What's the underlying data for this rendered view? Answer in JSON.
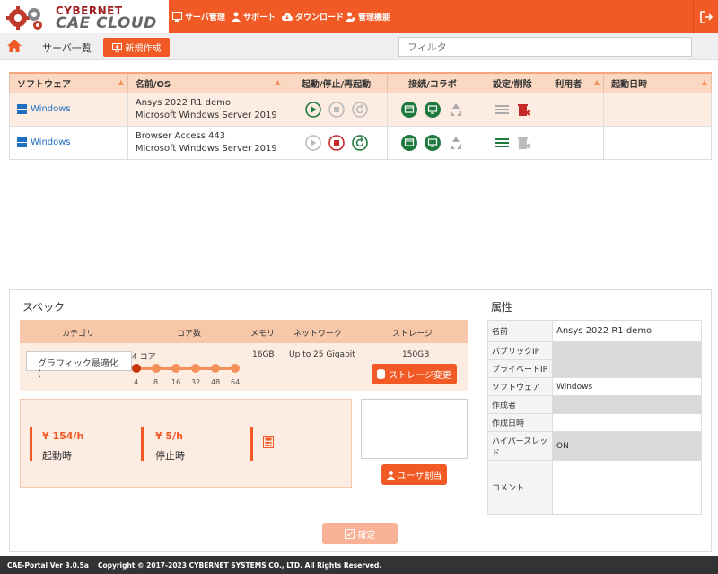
{
  "brand": {
    "line1": "CYBERNET",
    "line2": "CAE CLOUD"
  },
  "nav": {
    "items": [
      {
        "label": "サーバ管理",
        "icon": "server-icon"
      },
      {
        "label": "サポート",
        "icon": "support-icon"
      },
      {
        "label": "ダウンロード",
        "icon": "cloud-download-icon"
      },
      {
        "label": "管理機能",
        "icon": "admin-user-icon"
      }
    ]
  },
  "subheader": {
    "breadcrumb": "サーバ一覧",
    "new_button": "新規作成",
    "filter_placeholder": "フィルタ"
  },
  "table": {
    "headers": [
      "ソフトウェア",
      "名前/OS",
      "起動/停止/再起動",
      "接続/コラボ",
      "設定/削除",
      "利用者",
      "起動日時"
    ],
    "rows": [
      {
        "software": "Windows",
        "name": "Ansys 2022 R1 demo",
        "os": "Microsoft Windows Server 2019",
        "user": "",
        "started": ""
      },
      {
        "software": "Windows",
        "name": "Browser Access 443",
        "os": "Microsoft Windows Server 2019",
        "user": "",
        "started": ""
      }
    ]
  },
  "spec": {
    "title": "スペック",
    "headers": {
      "category": "カテゴリ",
      "cores": "コア数",
      "memory": "メモリ",
      "network": "ネットワーク",
      "storage": "ストレージ"
    },
    "category_value": "グラフィック最適化(",
    "cores_value": "4 コア",
    "core_ticks": [
      "4",
      "8",
      "16",
      "32",
      "48",
      "64"
    ],
    "memory_value": "16GB",
    "network_value": "Up to 25 Gigabit",
    "storage_value": "150GB",
    "storage_button": "ストレージ変更",
    "price_running": "¥ 154/h",
    "price_running_label": "起動時",
    "price_stopped": "¥ 5/h",
    "price_stopped_label": "停止時",
    "user_button": "ユーザ割当",
    "confirm_button": "確定"
  },
  "attributes": {
    "title": "属性",
    "rows": [
      {
        "key": "名前",
        "value": "Ansys 2022 R1 demo"
      },
      {
        "key": "パブリックIP",
        "value": ""
      },
      {
        "key": "プライベートIP",
        "value": ""
      },
      {
        "key": "ソフトウェア",
        "value": "Windows"
      },
      {
        "key": "作成者",
        "value": ""
      },
      {
        "key": "作成日時",
        "value": ""
      },
      {
        "key": "ハイパースレッド",
        "value": "ON"
      },
      {
        "key": "コメント",
        "value": ""
      }
    ]
  },
  "footer": {
    "version": "CAE-Portal Ver 3.0.5a",
    "copyright": "Copyright © 2017-2023 CYBERNET SYSTEMS CO., LTD. All Rights Reserved."
  },
  "colors": {
    "accent": "#f15a24",
    "header_bg": "#fbd8c2",
    "row_bg": "#fcece2",
    "green": "#1e7a3c",
    "red": "#c62828"
  }
}
